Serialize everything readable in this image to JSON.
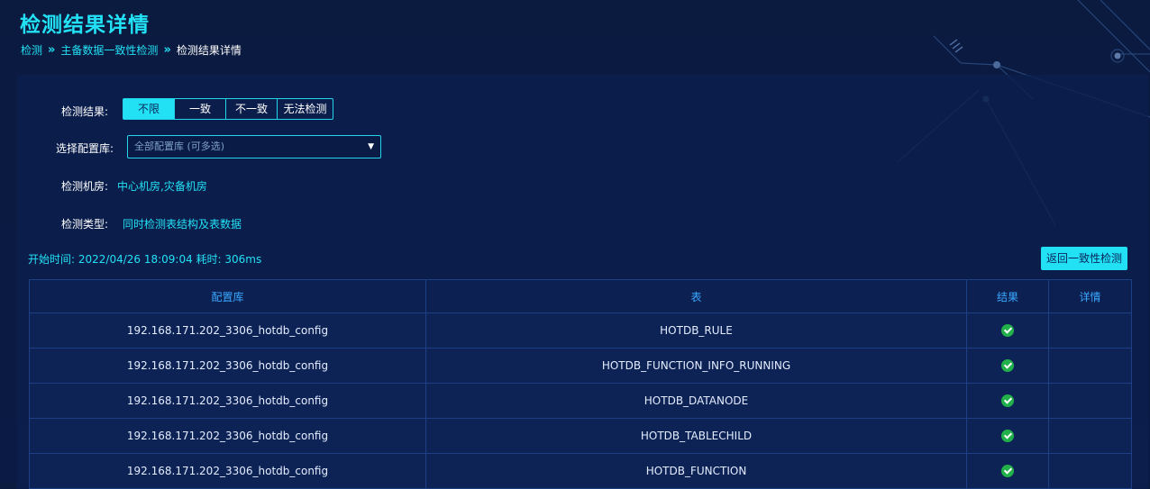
{
  "title": "检测结果详情",
  "breadcrumb": {
    "items": [
      "检测",
      "主备数据一致性检测"
    ],
    "separator": "»",
    "current": "检测结果详情"
  },
  "form": {
    "result_label": "检测结果:",
    "result_options": [
      "不限",
      "一致",
      "不一致",
      "无法检测"
    ],
    "result_selected": "不限",
    "config_label": "选择配置库:",
    "config_placeholder": "全部配置库 (可多选)",
    "room_label": "检测机房:",
    "room_value": "中心机房,灾备机房",
    "type_label": "检测类型:",
    "type_value": "同时检测表结构及表数据"
  },
  "time_info": "开始时间: 2022/04/26 18:09:04 耗时: 306ms",
  "return_button": "返回一致性检测",
  "table": {
    "headers": [
      "配置库",
      "表",
      "结果",
      "详情"
    ],
    "rows": [
      {
        "config": "192.168.171.202_3306_hotdb_config",
        "table": "HOTDB_RULE",
        "result": "check-circle-icon",
        "detail": ""
      },
      {
        "config": "192.168.171.202_3306_hotdb_config",
        "table": "HOTDB_FUNCTION_INFO_RUNNING",
        "result": "check-circle-icon",
        "detail": ""
      },
      {
        "config": "192.168.171.202_3306_hotdb_config",
        "table": "HOTDB_DATANODE",
        "result": "check-circle-icon",
        "detail": ""
      },
      {
        "config": "192.168.171.202_3306_hotdb_config",
        "table": "HOTDB_TABLECHILD",
        "result": "check-circle-icon",
        "detail": ""
      },
      {
        "config": "192.168.171.202_3306_hotdb_config",
        "table": "HOTDB_FUNCTION",
        "result": "check-circle-icon",
        "detail": ""
      }
    ]
  },
  "colors": {
    "accent": "#23e1f5",
    "background": "#0b1a3f",
    "success": "#22b04a",
    "header_text": "#3aa8ff"
  }
}
